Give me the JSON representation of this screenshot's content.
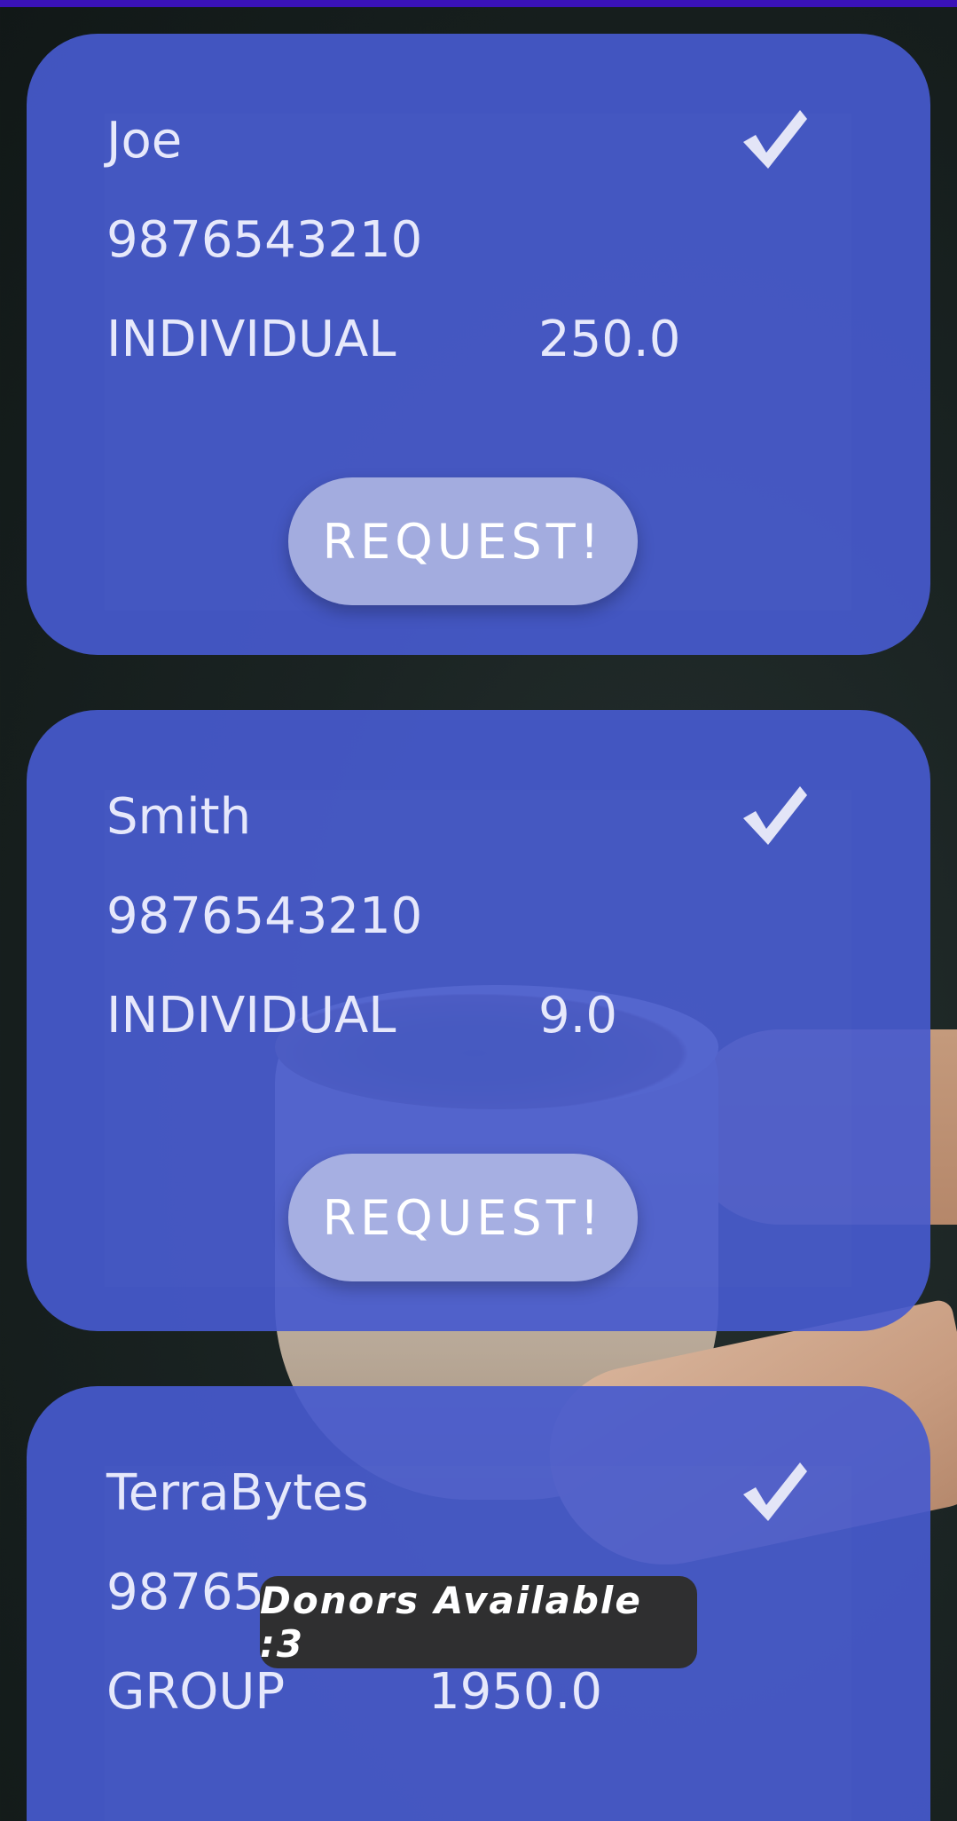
{
  "donors": [
    {
      "name": "Joe",
      "phone": "9876543210",
      "type": "INDIVIDUAL",
      "amount": "250.0",
      "button_label": "REQUEST!"
    },
    {
      "name": "Smith",
      "phone": "9876543210",
      "type": "INDIVIDUAL",
      "amount": "9.0",
      "button_label": "REQUEST!"
    },
    {
      "name": "TerraBytes",
      "phone": "98765",
      "type": "GROUP",
      "amount": "1950.0"
    }
  ],
  "toast": {
    "text": "Donors Available :3"
  },
  "colors": {
    "card": "#475ace",
    "status_strip": "#3a12b8",
    "toast": "#2f2f30"
  },
  "icons": {
    "verified": "check-icon"
  }
}
